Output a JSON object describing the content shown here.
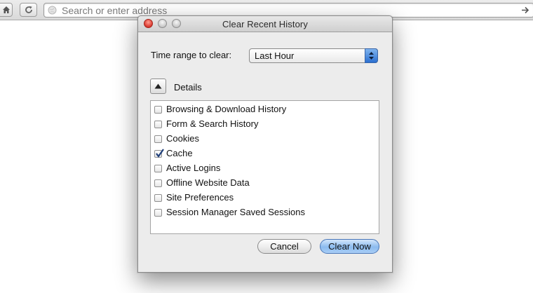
{
  "toolbar": {
    "home_icon": "home-icon",
    "reload_icon": "reload-icon",
    "url_placeholder": "Search or enter address",
    "url_value": "",
    "go_icon": "arrow-right-icon"
  },
  "dialog": {
    "title": "Clear Recent History",
    "time_range_label": "Time range to clear:",
    "time_range_value": "Last Hour",
    "details_label": "Details",
    "items": [
      {
        "label": "Browsing & Download History",
        "checked": false
      },
      {
        "label": "Form & Search History",
        "checked": false
      },
      {
        "label": "Cookies",
        "checked": false
      },
      {
        "label": "Cache",
        "checked": true
      },
      {
        "label": "Active Logins",
        "checked": false
      },
      {
        "label": "Offline Website Data",
        "checked": false
      },
      {
        "label": "Site Preferences",
        "checked": false
      },
      {
        "label": "Session Manager Saved Sessions",
        "checked": false
      }
    ],
    "cancel_label": "Cancel",
    "clear_label": "Clear Now"
  },
  "colors": {
    "accent": "#2b6fd0",
    "close_light": "#e0443a",
    "check": "#1f3f7a"
  }
}
